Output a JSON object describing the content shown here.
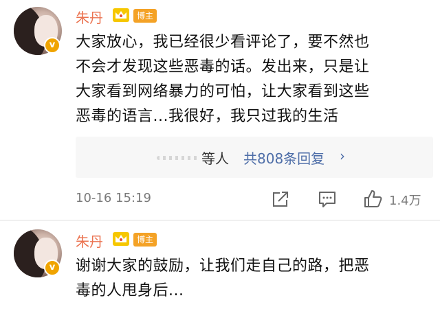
{
  "comments": [
    {
      "author": "朱丹",
      "author_badge": "博主",
      "text_lines": [
        "大家放心，我已经很少看评论了，要不然也",
        "不会才发现这些恶毒的话。发出来，只是让",
        "大家看到网络暴力的可怕，让大家看到这些",
        "恶毒的语言...我很好，我只过我的生活"
      ],
      "replies": {
        "who": "等人",
        "count_label": "共808条回复",
        "chevron": "›"
      },
      "timestamp": "10-16 15:19",
      "likes": "1.4万"
    },
    {
      "author": "朱丹",
      "author_badge": "博主",
      "text_lines": [
        "谢谢大家的鼓励，让我们走自己的路，把恶",
        "毒的人甩身后..."
      ]
    }
  ],
  "colors": {
    "name": "#eb7350",
    "link": "#4e6ea8",
    "badge": "#f4a226",
    "verified": "#f0a400"
  },
  "icons": {
    "share": "share-icon",
    "comment": "comment-icon",
    "like": "like-icon",
    "crown": "crown-icon"
  }
}
